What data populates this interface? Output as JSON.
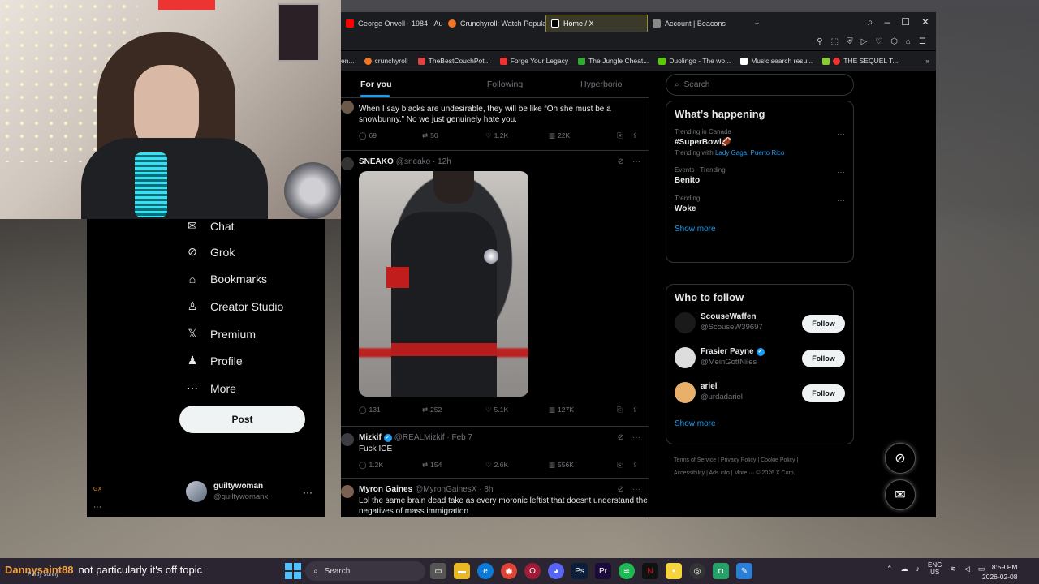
{
  "browser": {
    "tabs": [
      {
        "label": "George Orwell - 1984 - Au",
        "color": "#ff0000",
        "active": false
      },
      {
        "label": "Crunchyroll: Watch Popula",
        "color": "#f47521",
        "active": false
      },
      {
        "label": "Home / X",
        "color": "#000000",
        "active": true
      },
      {
        "label": "Account | Beacons",
        "color": "#888888",
        "active": false
      }
    ],
    "new_tab": "+",
    "bookmarks": [
      {
        "label": "en...",
        "color": "#888888"
      },
      {
        "label": "crunchyroll",
        "color": "#f47521"
      },
      {
        "label": "TheBestCouchPot...",
        "color": "#d44"
      },
      {
        "label": "Forge Your Legacy",
        "color": "#e33"
      },
      {
        "label": "The Jungle Cheat...",
        "color": "#3a3"
      },
      {
        "label": "Duolingo - The wo...",
        "color": "#58cc02"
      },
      {
        "label": "Music search resu...",
        "color": "#ffffff"
      },
      {
        "label": "THE SEQUEL T...",
        "color": "#e33"
      }
    ]
  },
  "feed_tabs": [
    "For you",
    "Following",
    "Hyperborio"
  ],
  "posts": [
    {
      "name": "",
      "handle": "",
      "text": "When I say blacks are undesirable, they will be like “Oh she must be a snowbunny.” No we just genuinely hate you.",
      "replies": "69",
      "reposts": "50",
      "likes": "1.2K",
      "views": "22K"
    },
    {
      "name": "SNEAKO",
      "handle": "@sneako · 12h",
      "text": "",
      "replies": "131",
      "reposts": "252",
      "likes": "5.1K",
      "views": "127K"
    },
    {
      "name": "Mizkif",
      "handle": "@REALMizkif · Feb 7",
      "text": "Fuck ICE",
      "replies": "1.2K",
      "reposts": "154",
      "likes": "2.6K",
      "views": "556K"
    },
    {
      "name": "Myron Gaines",
      "handle": "@MyronGainesX · 8h",
      "text": "Lol the same brain dead take as every moronic leftist that doesnt understand the negatives of mass immigration",
      "replies": "",
      "reposts": "",
      "likes": "",
      "views": ""
    }
  ],
  "search_placeholder": "Search",
  "happening": {
    "title": "What’s happening",
    "trends": [
      {
        "meta": "Trending in Canada",
        "topic": "#SuperBowl🏈",
        "with_label": "Trending with",
        "with": "Lady Gaga, Puerto Rico"
      },
      {
        "meta": "Events · Trending",
        "topic": "Benito",
        "with_label": "",
        "with": ""
      },
      {
        "meta": "Trending",
        "topic": "Woke",
        "with_label": "",
        "with": ""
      }
    ],
    "show_more": "Show more"
  },
  "who_to_follow": {
    "title": "Who to follow",
    "users": [
      {
        "name": "ScouseWaffen",
        "handle": "@ScouseW39697",
        "verified": false,
        "color": "#222222"
      },
      {
        "name": "Frasier Payne",
        "handle": "@MeinGottNiles",
        "verified": true,
        "color": "#dddddd"
      },
      {
        "name": "ariel",
        "handle": "@urdadariel",
        "verified": false,
        "color": "#e8b06a"
      }
    ],
    "follow_label": "Follow",
    "show_more": "Show more"
  },
  "footer": {
    "line1": "Terms of Service  |  Privacy Policy  |  Cookie Policy  |",
    "line2": "Accessibility  |  Ads info  |  More ···  © 2026 X Corp."
  },
  "left_nav": [
    {
      "label": "Chat",
      "icon": "✉"
    },
    {
      "label": "Grok",
      "icon": "⊘"
    },
    {
      "label": "Bookmarks",
      "icon": "⌂"
    },
    {
      "label": "Creator Studio",
      "icon": "♙"
    },
    {
      "label": "Premium",
      "icon": "𝕏"
    },
    {
      "label": "Profile",
      "icon": "♟"
    },
    {
      "label": "More",
      "icon": "⋯"
    }
  ],
  "post_button": "Post",
  "account": {
    "name": "guiltywoman",
    "handle": "@guiltywomanx"
  },
  "sidebar_gx": "GX",
  "stream_chat": {
    "user": "Dannysaint88",
    "message": "not particularly it's off topic"
  },
  "weather": "Partly sunny",
  "taskbar": {
    "search": "Search",
    "lang": "ENG",
    "region": "US",
    "time": "8:59 PM",
    "date": "2026-02-08"
  }
}
